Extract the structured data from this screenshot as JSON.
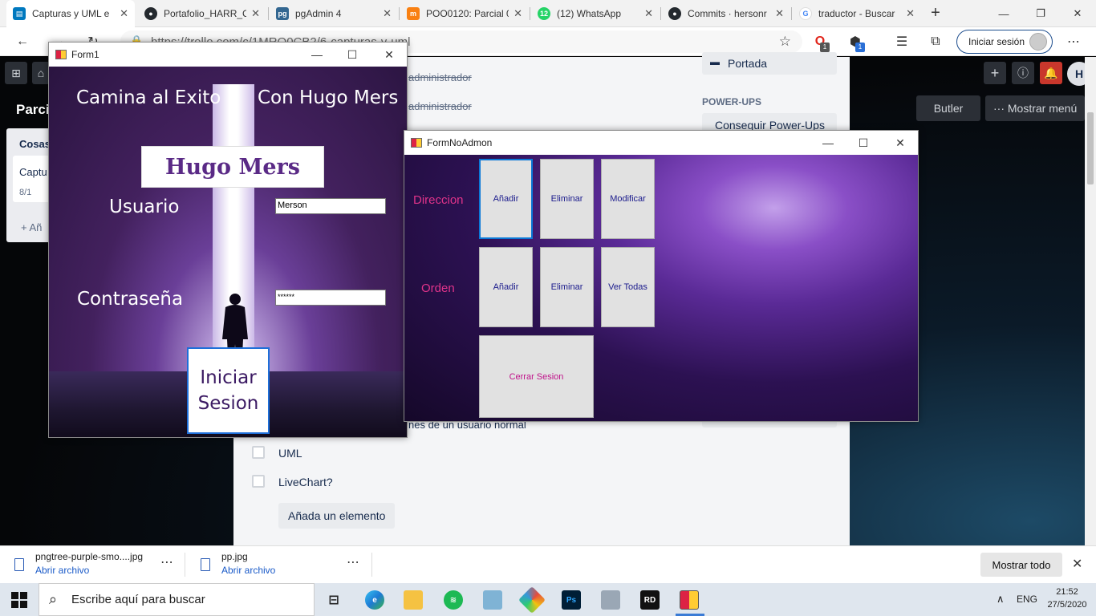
{
  "browser": {
    "tabs": [
      {
        "title": "Capturas y UML e",
        "favicon": "trello-icon",
        "color": "#0079bf",
        "active": true
      },
      {
        "title": "Portafolio_HARR_C",
        "favicon": "github-icon",
        "color": "#24292e"
      },
      {
        "title": "pgAdmin 4",
        "favicon": "pgadmin-icon",
        "color": "#336791"
      },
      {
        "title": "POO0120: Parcial 0",
        "favicon": "moodle-icon",
        "color": "#f98012"
      },
      {
        "title": "(12) WhatsApp",
        "favicon": "whatsapp-icon",
        "color": "#25d366",
        "badge": "12"
      },
      {
        "title": "Commits · hersonr",
        "favicon": "github-icon",
        "color": "#24292e"
      },
      {
        "title": "traductor - Buscar",
        "favicon": "google-icon",
        "color": "#4285f4"
      }
    ],
    "url": "https://trello.com/c/1MRO0CB2/6-capturas-y-uml",
    "signin_label": "Iniciar sesión",
    "ext_badge_1": "1",
    "ext_badge_2": "1"
  },
  "trello": {
    "board_title": "Parci",
    "list_title": "Cosas",
    "card_title": "Captu",
    "card_badge": "8/1",
    "add_card": "+ Añ",
    "butler": "Butler",
    "show_menu": "··· Mostrar menú",
    "header_avatar": "H",
    "checklist": [
      {
        "text": "administrador",
        "done": true
      },
      {
        "text": "administrador",
        "done": true
      },
      {
        "text": "nes de un usuario normal",
        "done": false
      },
      {
        "text": "UML",
        "done": false
      },
      {
        "text": "LiveChart?",
        "done": false
      }
    ],
    "add_item": "Añada un elemento",
    "sidebar": {
      "cover": "Portada",
      "powerups_heading": "POWER-UPS",
      "get_powerups": "Conseguir Power-Ups"
    }
  },
  "form1": {
    "title": "Form1",
    "heading_left": "Camina al Exito",
    "heading_right": "Con Hugo Mers",
    "banner": "Hugo Mers",
    "user_label": "Usuario",
    "user_value": "Merson",
    "pass_label": "Contraseña",
    "pass_value": "******",
    "login_button": "Iniciar Sesion"
  },
  "form2": {
    "title": "FormNoAdmon",
    "direccion_label": "Direccion",
    "orden_label": "Orden",
    "dir_add": "Añadir",
    "dir_delete": "Eliminar",
    "dir_modify": "Modificar",
    "ord_add": "Añadir",
    "ord_delete": "Eliminar",
    "ord_view_all": "Ver Todas",
    "logout": "Cerrar Sesion"
  },
  "downloads": {
    "items": [
      {
        "name": "pngtree-purple-smo....jpg",
        "action": "Abrir archivo"
      },
      {
        "name": "pp.jpg",
        "action": "Abrir archivo"
      }
    ],
    "show_all": "Mostrar todo"
  },
  "taskbar": {
    "search_placeholder": "Escribe aquí para buscar",
    "lang": "ENG",
    "time": "21:52",
    "date": "27/5/2020"
  }
}
